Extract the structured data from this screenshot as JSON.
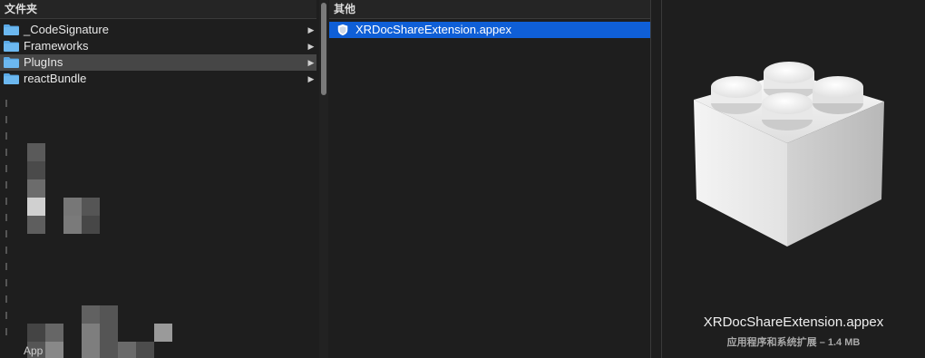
{
  "columns": {
    "first": {
      "header": "文件夹",
      "items": [
        {
          "label": "_CodeSignature",
          "chevron": "▶"
        },
        {
          "label": "Frameworks",
          "chevron": "▶"
        },
        {
          "label": "PlugIns",
          "chevron": "▶"
        },
        {
          "label": "reactBundle",
          "chevron": "▶"
        }
      ],
      "obscured_fragment": "App"
    },
    "second": {
      "header": "其他",
      "items": [
        {
          "label": "XRDocShareExtension.appex"
        }
      ]
    }
  },
  "preview": {
    "filename": "XRDocShareExtension.appex",
    "description": "应用程序和系统扩展 – 1.4 MB",
    "icon": "lego-brick-extension-icon"
  },
  "colors": {
    "selection": "#0f5fd7",
    "hover": "#464646",
    "folder": "#5aa9e6",
    "background": "#1e1e1e"
  }
}
